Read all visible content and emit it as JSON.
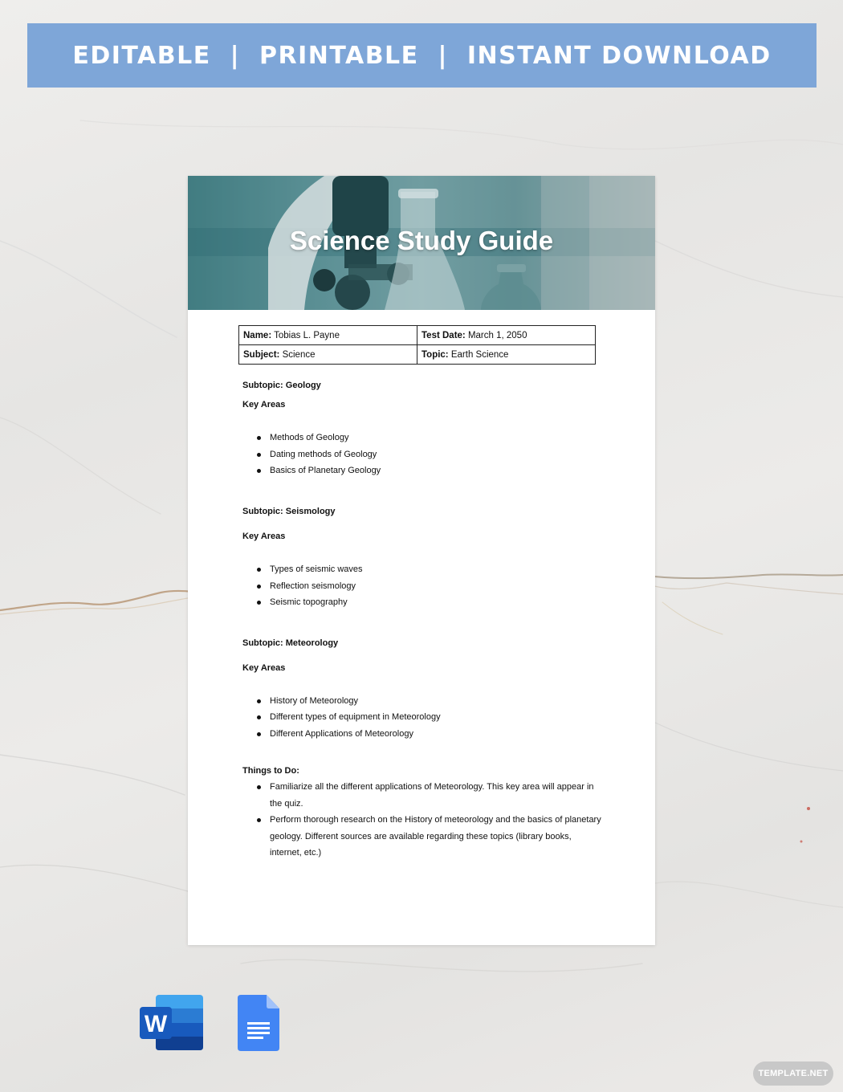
{
  "banner": {
    "text": "EDITABLE  |  PRINTABLE  |  INSTANT DOWNLOAD",
    "color": "#7ea6d8"
  },
  "document": {
    "title": "Science Study Guide",
    "hero_image": "laboratory microscope and flasks",
    "info": {
      "name_label": "Name:",
      "name_value": " Tobias L. Payne",
      "test_date_label": "Test Date:",
      "test_date_value": " March 1, 2050",
      "subject_label": "Subject:",
      "subject_value": " Science",
      "topic_label": "Topic:",
      "topic_value": " Earth Science"
    },
    "sections": [
      {
        "subtopic": "Subtopic: Geology",
        "key_areas_label": "Key Areas",
        "items": [
          "Methods of Geology",
          "Dating methods of Geology",
          "Basics of Planetary Geology"
        ]
      },
      {
        "subtopic": "Subtopic: Seismology",
        "key_areas_label": "Key Areas",
        "items": [
          "Types of seismic waves",
          "Reflection seismology",
          "Seismic topography"
        ]
      },
      {
        "subtopic": "Subtopic: Meteorology",
        "key_areas_label": "Key Areas",
        "items": [
          "History of Meteorology",
          "Different types of equipment in Meteorology",
          "Different Applications of Meteorology"
        ]
      }
    ],
    "things_to_do": {
      "label": "Things to Do:",
      "items": [
        "Familiarize all the different applications of Meteorology. This key area will appear in the quiz.",
        "Perform thorough research on the History of meteorology and the basics of planetary geology. Different sources are available regarding these topics (library books, internet, etc.)"
      ]
    }
  },
  "format_icons": [
    {
      "name": "microsoft-word-icon",
      "letter": "W"
    },
    {
      "name": "google-docs-icon"
    }
  ],
  "watermark": "TEMPLATE.NET"
}
